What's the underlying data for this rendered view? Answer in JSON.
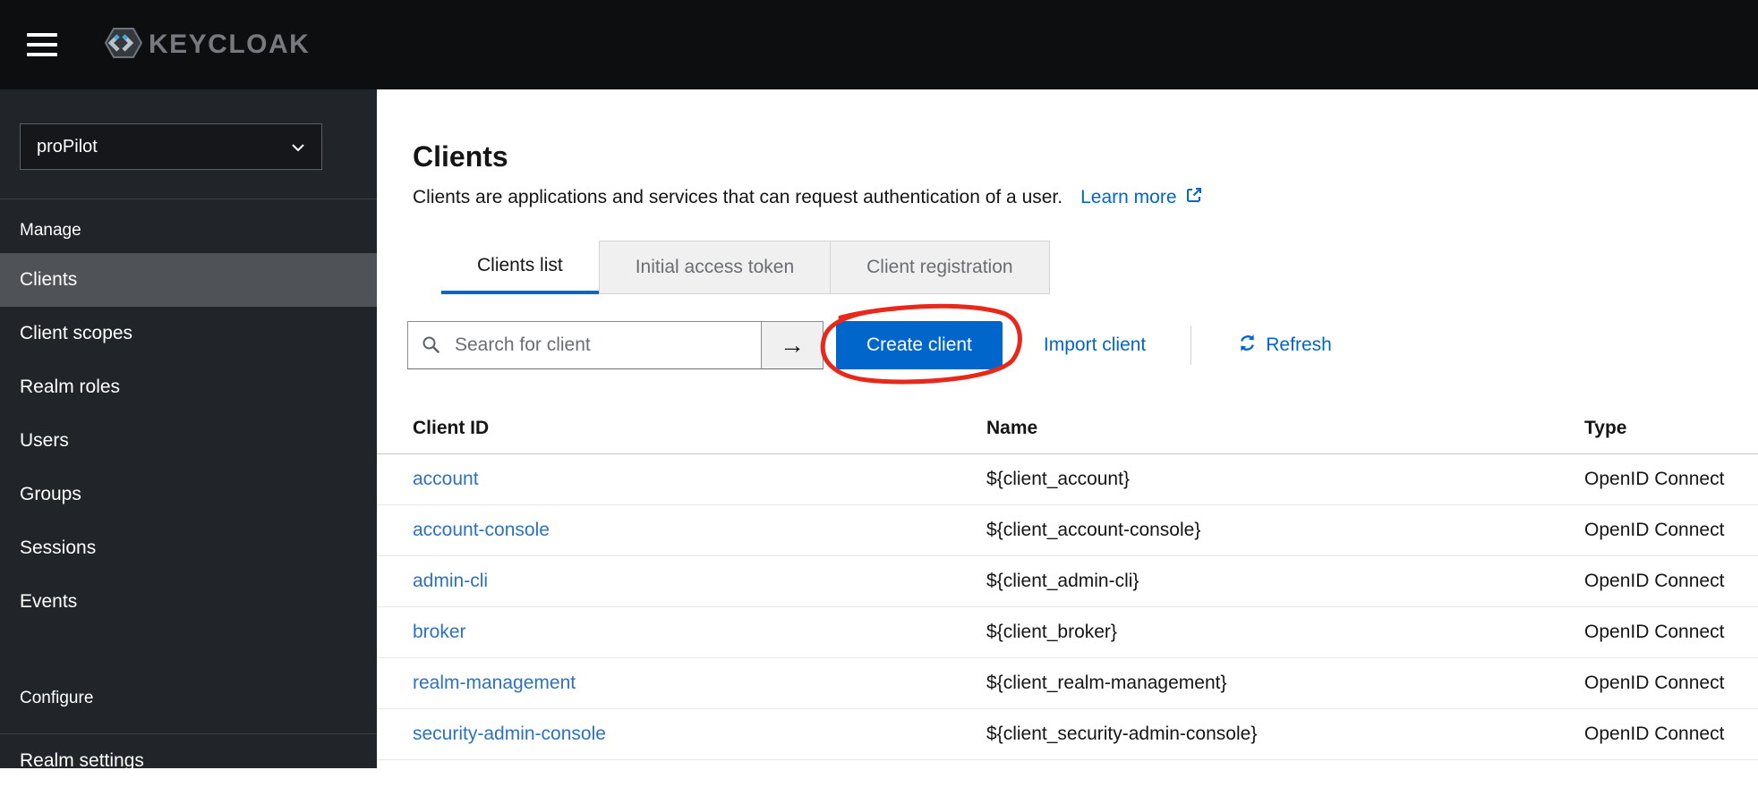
{
  "topbar": {
    "logo_text": "KEYCLOAK"
  },
  "sidebar": {
    "realm_selector": {
      "value": "proPilot"
    },
    "groups": [
      {
        "label": "Manage",
        "active_item": "Clients",
        "items": [
          "Clients",
          "Client scopes",
          "Realm roles",
          "Users",
          "Groups",
          "Sessions",
          "Events"
        ]
      },
      {
        "label": "Configure",
        "items": [
          "Realm settings"
        ]
      }
    ]
  },
  "main": {
    "title": "Clients",
    "subtitle": "Clients are applications and services that can request authentication of a user.",
    "learn_more_label": "Learn more",
    "active_tab": "Clients list",
    "tabs": [
      "Clients list",
      "Initial access token",
      "Client registration"
    ],
    "toolbar": {
      "search_placeholder": "Search for client",
      "go_button": "→",
      "create_button_label": "Create client",
      "import_link_label": "Import client",
      "refresh_label": "Refresh"
    },
    "annotation": {
      "shape": "hand-drawn-circle",
      "around": "create-client-button",
      "color": "#e8281a"
    },
    "table": {
      "headers": [
        "Client ID",
        "Name",
        "Type"
      ],
      "rows": [
        {
          "client_id": "account",
          "name": "${client_account}",
          "type": "OpenID Connect"
        },
        {
          "client_id": "account-console",
          "name": "${client_account-console}",
          "type": "OpenID Connect"
        },
        {
          "client_id": "admin-cli",
          "name": "${client_admin-cli}",
          "type": "OpenID Connect"
        },
        {
          "client_id": "broker",
          "name": "${client_broker}",
          "type": "OpenID Connect"
        },
        {
          "client_id": "realm-management",
          "name": "${client_realm-management}",
          "type": "OpenID Connect"
        },
        {
          "client_id": "security-admin-console",
          "name": "${client_security-admin-console}",
          "type": "OpenID Connect"
        }
      ]
    }
  },
  "colors": {
    "accent_blue": "#0066cc",
    "table_link_blue": "#2d71c2",
    "annotation_red": "#e8281a",
    "topbar_bg": "#0d0e10",
    "sidebar_bg": "#212428",
    "active_nav_bg": "#4f5256"
  }
}
